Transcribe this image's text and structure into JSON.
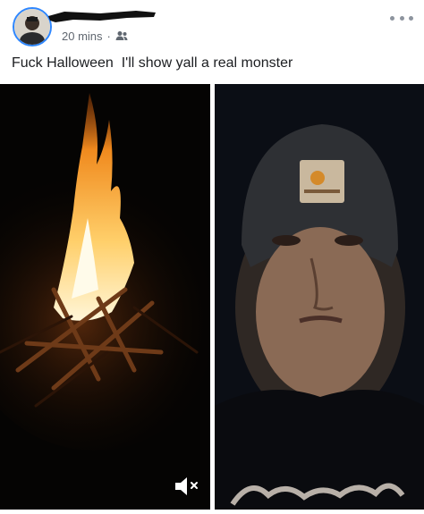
{
  "post": {
    "timestamp": "20 mins",
    "separator": "·",
    "audience_icon": "friends-icon",
    "caption": "Fuck Halloween  I'll show yall a real monster",
    "more_icon": "more-options-icon"
  },
  "media": {
    "photos": [
      {
        "description_icon": "campfire-photo"
      },
      {
        "description_icon": "selfie-photo"
      }
    ],
    "mute_icon": "volume-muted-icon"
  },
  "colors": {
    "accent": "#2d86ff",
    "secondary_text": "#606770",
    "primary_text": "#1c1e21"
  }
}
